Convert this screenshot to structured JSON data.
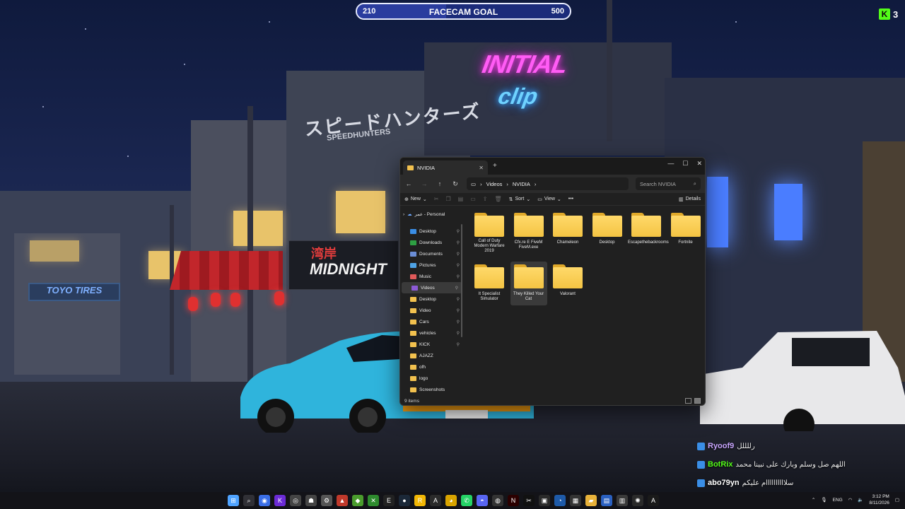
{
  "goal": {
    "current": "210",
    "label": "FACECAM GOAL",
    "max": "500",
    "progress_fraction": 0.42
  },
  "kick": {
    "logo": "K",
    "count": "3"
  },
  "wallpaper": {
    "neon_title": "INITIAL",
    "neon_sub": "clip",
    "sign_jp": "スピードハンターズ",
    "sign_jp_sub": "SPEEDHUNTERS",
    "midnight_jp": "湾岸",
    "midnight": "MIDNIGHT",
    "toyo": "TOYO TIRES"
  },
  "explorer": {
    "tab_title": "NVIDIA",
    "breadcrumb": [
      "Videos",
      "NVIDIA"
    ],
    "search_placeholder": "Search NVIDIA",
    "toolbar": {
      "new": "New",
      "sort": "Sort",
      "view": "View",
      "more": "•••",
      "details": "Details"
    },
    "sidebar_group": "عمر - Personal",
    "sidebar": [
      {
        "label": "Desktop",
        "color": "#3a8ee6",
        "pinned": true
      },
      {
        "label": "Downloads",
        "color": "#2ea043",
        "pinned": true
      },
      {
        "label": "Documents",
        "color": "#6b8ed6",
        "pinned": true
      },
      {
        "label": "Pictures",
        "color": "#4ea3e6",
        "pinned": true
      },
      {
        "label": "Music",
        "color": "#e05a5a",
        "pinned": true
      },
      {
        "label": "Videos",
        "color": "#8c5ad6",
        "pinned": true,
        "selected": true
      },
      {
        "label": "Desktop",
        "color": "#f2c14e",
        "pinned": true
      },
      {
        "label": "Video",
        "color": "#f2c14e",
        "pinned": true
      },
      {
        "label": "Cars",
        "color": "#f2c14e",
        "pinned": true
      },
      {
        "label": "vehicles",
        "color": "#f2c14e",
        "pinned": true
      },
      {
        "label": "KICK",
        "color": "#f2c14e",
        "pinned": true
      },
      {
        "label": "AJAZZ",
        "color": "#f2c14e",
        "pinned": false
      },
      {
        "label": "ofh",
        "color": "#f2c14e",
        "pinned": false
      },
      {
        "label": "logo",
        "color": "#f2c14e",
        "pinned": false
      },
      {
        "label": "Screenshots",
        "color": "#f2c14e",
        "pinned": false
      }
    ],
    "files": [
      {
        "label": "Call of Duty Modern Warfare 2019"
      },
      {
        "label": "Cfx.re  E  FiveM FiveM.exe"
      },
      {
        "label": "Chameleon"
      },
      {
        "label": "Desktop"
      },
      {
        "label": "Escapethebackrooms"
      },
      {
        "label": "Fortnite"
      },
      {
        "label": "It Specialist Simulator"
      },
      {
        "label": "They Killed Your Cat",
        "hover": true
      },
      {
        "label": "Valorant"
      }
    ],
    "status": "9 items"
  },
  "chat": [
    {
      "name": "Ryoof9",
      "name_color": "#c9a6ff",
      "msg": "رللللل"
    },
    {
      "name": "BotRix",
      "name_color": "#53fc18",
      "msg": "اللهم صل وسلم وبارك على نبينا محمد"
    },
    {
      "name": "abo79yn",
      "name_color": "#ffffff",
      "msg": "سلاااااااااام عليكم"
    }
  ],
  "taskbar": {
    "apps": [
      {
        "icon": "windows-start-icon",
        "color": "#4fa3ff",
        "glyph": "⊞"
      },
      {
        "icon": "search-icon",
        "color": "#303036",
        "glyph": "⌕"
      },
      {
        "icon": "browser-icon",
        "color": "#3a6ee6",
        "glyph": "◉"
      },
      {
        "icon": "kick-app-icon",
        "color": "#6b2bd6",
        "glyph": "K"
      },
      {
        "icon": "ring-app-icon",
        "color": "#444",
        "glyph": "◎"
      },
      {
        "icon": "ghost-app-icon",
        "color": "#444",
        "glyph": "☗"
      },
      {
        "icon": "settings-icon",
        "color": "#555",
        "glyph": "⚙"
      },
      {
        "icon": "delta-app-icon",
        "color": "#c0392b",
        "glyph": "▲"
      },
      {
        "icon": "nvidia-app-icon",
        "color": "#4a9c2d",
        "glyph": "◆"
      },
      {
        "icon": "xbox-icon",
        "color": "#2e8b2e",
        "glyph": "✕"
      },
      {
        "icon": "epic-icon",
        "color": "#222",
        "glyph": "E"
      },
      {
        "icon": "steam-icon",
        "color": "#1b2838",
        "glyph": "●"
      },
      {
        "icon": "rockstar-icon",
        "color": "#f2b705",
        "glyph": "R"
      },
      {
        "icon": "adobe-icon",
        "color": "#2b2b2b",
        "glyph": "A"
      },
      {
        "icon": "chrome-icon",
        "color": "#d9a400",
        "glyph": "◕"
      },
      {
        "icon": "whatsapp-icon",
        "color": "#25d366",
        "glyph": "✆"
      },
      {
        "icon": "discord-icon",
        "color": "#5865f2",
        "glyph": "◓"
      },
      {
        "icon": "obs-icon",
        "color": "#333",
        "glyph": "◍"
      },
      {
        "icon": "netflix-icon",
        "color": "#2b0000",
        "glyph": "N"
      },
      {
        "icon": "capcut-icon",
        "color": "#111",
        "glyph": "✂"
      },
      {
        "icon": "terminal-icon",
        "color": "#2a2a2a",
        "glyph": "▣"
      },
      {
        "icon": "vpn-icon",
        "color": "#1e5aa8",
        "glyph": "◔"
      },
      {
        "icon": "calculator-icon",
        "color": "#333",
        "glyph": "▦"
      },
      {
        "icon": "file-explorer-icon",
        "color": "#e8b23a",
        "glyph": "▰"
      },
      {
        "icon": "photos-icon",
        "color": "#2a60c0",
        "glyph": "▤"
      },
      {
        "icon": "notepad-icon",
        "color": "#3a3a3a",
        "glyph": "▥"
      },
      {
        "icon": "chatgpt-icon",
        "color": "#2a2a2a",
        "glyph": "✺"
      },
      {
        "icon": "nvidia-overlay-icon",
        "color": "#1a1a1a",
        "glyph": "A"
      }
    ],
    "lang": "ENG",
    "time": "3:12 PM",
    "date": "8/11/2026"
  }
}
